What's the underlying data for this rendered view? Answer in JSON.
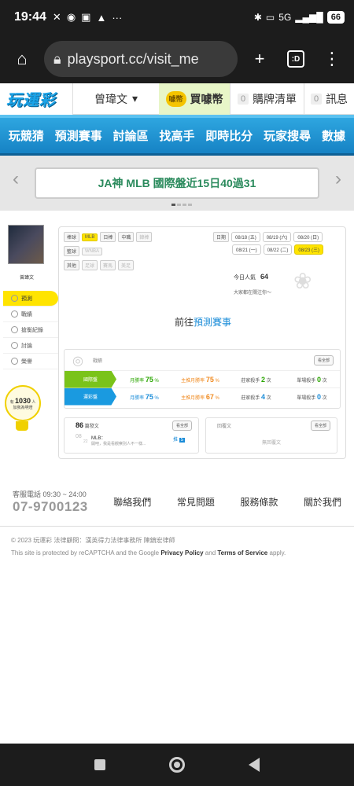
{
  "status": {
    "time": "19:44",
    "battery": "66",
    "network": "5G"
  },
  "browser": {
    "url": "playsport.cc/visit_me",
    "tab_count": ":D"
  },
  "site": {
    "logo_text": "玩運彩",
    "username": "曾瑋文",
    "coin_label": "買噱幣",
    "coin_icon_text": "噱幣",
    "cart_count": "0",
    "cart_label": "購牌清單",
    "msg_count": "0",
    "msg_label": "訊息"
  },
  "nav": [
    "玩競猜",
    "預測賽事",
    "討論區",
    "找高手",
    "即時比分",
    "玩家搜尋",
    "數據"
  ],
  "banner": {
    "text": "JA神 MLB 國際盤近15日40過31"
  },
  "profile": {
    "name": "曾瑋文",
    "menu": [
      "預測",
      "戰績",
      "allianceRecord",
      "討論",
      "榮譽"
    ],
    "menu_labels": {
      "m0": "預測",
      "m1": "戰績",
      "m2": "搶衡紀錄",
      "m3": "討論",
      "m4": "榮譽"
    },
    "likes": {
      "prefix": "有",
      "count": "1030",
      "suffix": "人",
      "line2": "加我為明燈"
    }
  },
  "panel": {
    "cats": {
      "c1": {
        "label": "棒球",
        "tags": [
          "MLB",
          "日棒",
          "中職",
          "韓棒"
        ]
      },
      "c2": {
        "label": "籃球",
        "tags": [
          "WNBA"
        ]
      },
      "c3": {
        "label": "其他",
        "tags": [
          "足球",
          "賽馬",
          "美足"
        ]
      }
    },
    "date_label": "日期",
    "dates_row1": [
      "08/18 (五)",
      "08/19 (六)",
      "08/20 (日)"
    ],
    "dates_row2": [
      "08/21 (一)",
      "08/22 (二)",
      "08/23 (三)"
    ],
    "pop_label": "今日人氣",
    "pop_value": "64",
    "pop_note": "大家都在關注你～",
    "goto_prefix": "前往",
    "goto_link": "預測賽事",
    "record": {
      "title": "戰績",
      "all_button": "看全部",
      "rows": [
        {
          "label": "國際盤",
          "win_label": "月勝率",
          "win": "75",
          "main_label": "主推月勝率",
          "main": "75",
          "streak_label": "莊家殺手",
          "streak": "2",
          "streak_unit": "次",
          "single_label": "單場殺手",
          "single": "0",
          "single_unit": "次"
        },
        {
          "label": "運彩盤",
          "win_label": "月勝率",
          "win": "75",
          "main_label": "主推月勝率",
          "main": "67",
          "streak_label": "莊家殺手",
          "streak": "4",
          "streak_unit": "次",
          "single_label": "單場殺手",
          "single": "0",
          "single_unit": "次"
        }
      ],
      "percent": "%"
    },
    "posts": {
      "count": "86",
      "label": "篇發文",
      "all_button": "看全部",
      "day": "08",
      "date_sub": "22",
      "title": "MLB：",
      "excerpt": "開吧，我是看觀察別人不一樣...",
      "push_label": "推",
      "push_count": "5"
    },
    "replies": {
      "title": "回覆文",
      "all_button": "看全部",
      "empty": "無回覆文"
    }
  },
  "footer": {
    "phone_label": "客服電話 09:30 ~ 24:00",
    "phone": "07-9700123",
    "links": [
      "聯絡我們",
      "常見問題",
      "服務條款",
      "關於我們"
    ],
    "copyright": "© 2023 玩運彩 法律顧問：漢英得力法律事務所 陳鎮宏律師",
    "recaptcha_prefix": "This site is protected by reCAPTCHA and the Google ",
    "privacy": "Privacy Policy",
    "and": " and ",
    "terms": "Terms of Service",
    "apply": " apply."
  },
  "colors": {
    "nav_blue": "#1682c4",
    "highlight_yellow": "#ffe400",
    "win_green": "#2aa500",
    "lottery_blue": "#1a8cd8"
  }
}
